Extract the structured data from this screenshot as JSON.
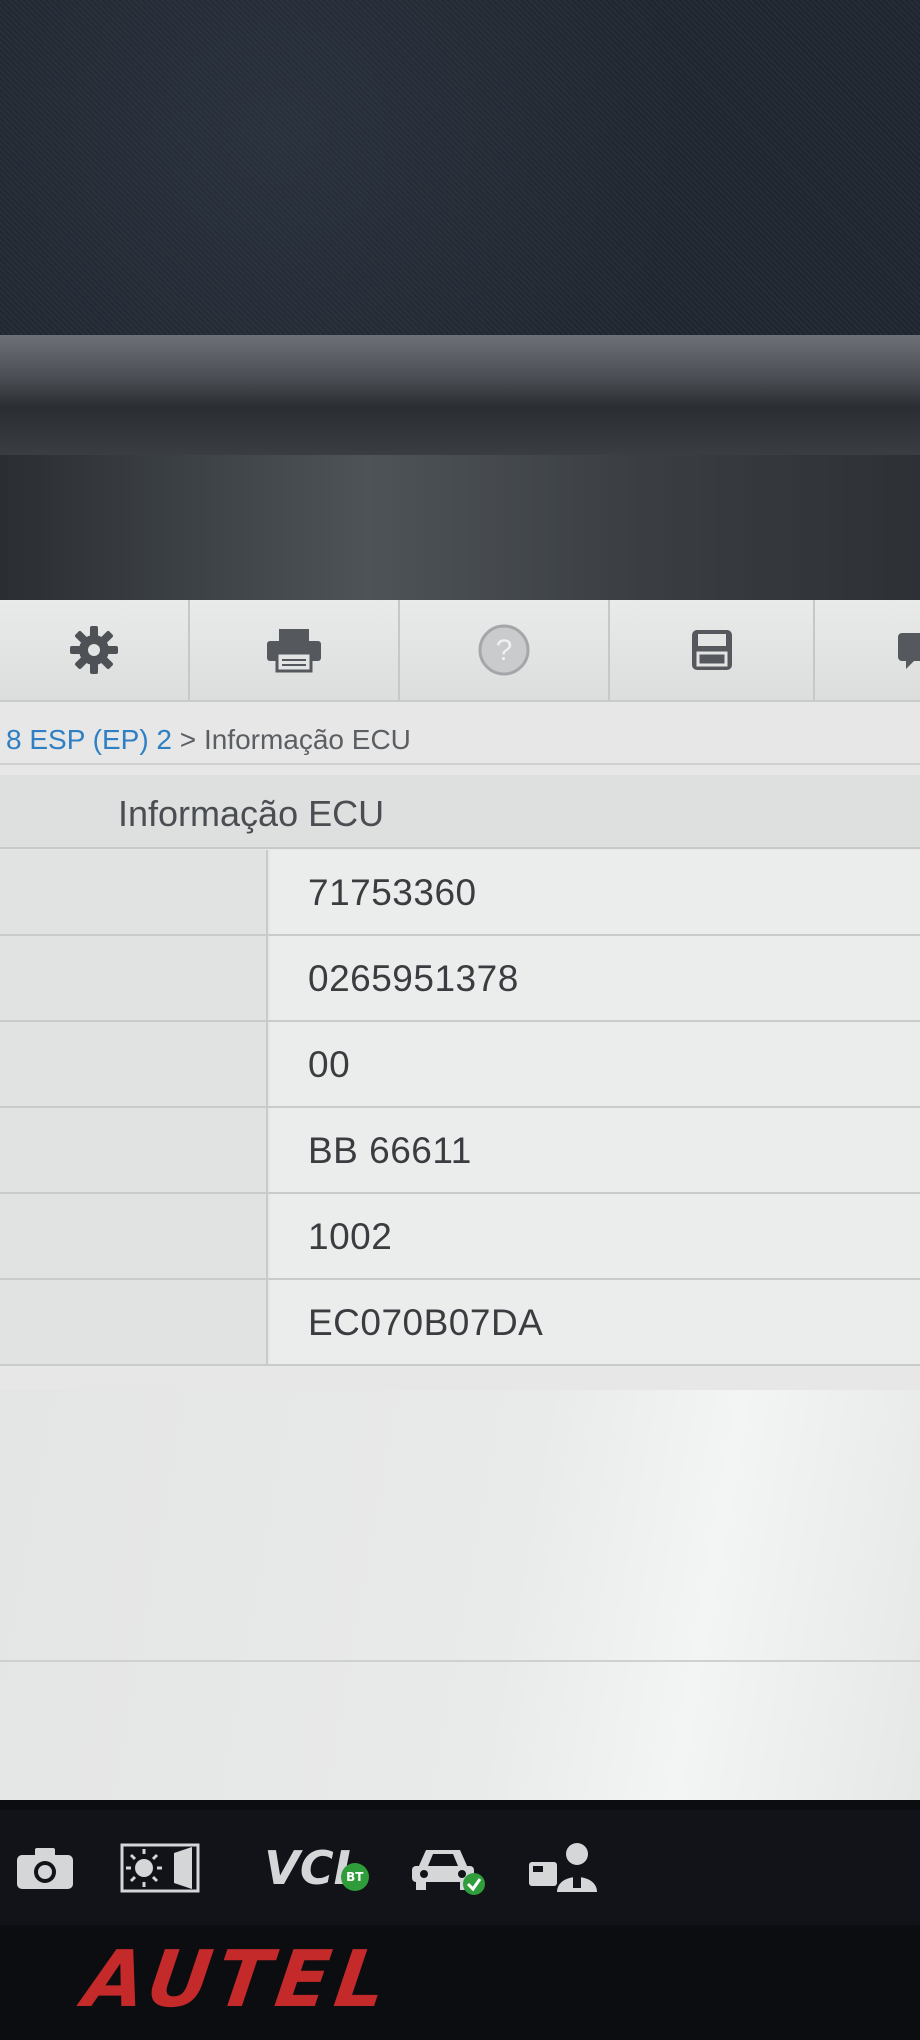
{
  "toolbar": {
    "buttons": [
      {
        "icon": "gear-icon"
      },
      {
        "icon": "printer-icon"
      },
      {
        "icon": "help-icon"
      },
      {
        "icon": "save-icon"
      },
      {
        "icon": "message-icon"
      }
    ]
  },
  "breadcrumb": {
    "link": "8 ESP (EP) 2",
    "separator": ">",
    "current": "Informação ECU"
  },
  "table": {
    "header": "Informação ECU",
    "rows": [
      {
        "label": "",
        "value": "71753360"
      },
      {
        "label": "",
        "value": "0265951378"
      },
      {
        "label": "",
        "value": "00"
      },
      {
        "label": "",
        "value": "BB 66611"
      },
      {
        "label": "",
        "value": "1002"
      },
      {
        "label": "",
        "value": "EC070B07DA"
      }
    ]
  },
  "taskbar": {
    "items": [
      {
        "icon": "camera-icon"
      },
      {
        "icon": "brightness-icon"
      },
      {
        "icon": "vci-icon",
        "label": "VCI",
        "badge": "BT"
      },
      {
        "icon": "vehicle-icon"
      },
      {
        "icon": "user-service-icon"
      }
    ]
  },
  "brand": {
    "name": "AUTEL",
    "color": "#c42a2a"
  },
  "colors": {
    "link": "#2f7fc4",
    "connected_badge": "#2f9d3a"
  }
}
